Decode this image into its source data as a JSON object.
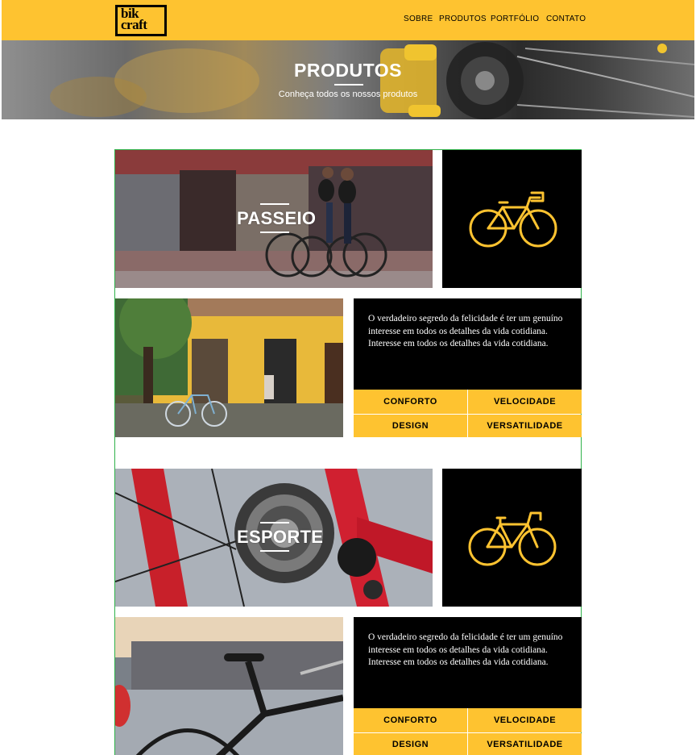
{
  "logo": {
    "line1": "bik",
    "line2": "craft"
  },
  "nav": [
    "SOBRE",
    "PRODUTOS",
    "PORTFÓLIO",
    "CONTATO"
  ],
  "banner": {
    "title": "PRODUTOS",
    "subtitle": "Conheça todos os nossos produtos"
  },
  "products": [
    {
      "title": "PASSEIO",
      "description": "O verdadeiro segredo da felicidade é ter um genuíno interesse em todos os detalhes da vida cotidiana. Interesse em todos os detalhes da vida cotidiana.",
      "features": [
        "CONFORTO",
        "VELOCIDADE",
        "DESIGN",
        "VERSATILIDADE"
      ]
    },
    {
      "title": "ESPORTE",
      "description": "O verdadeiro segredo da felicidade é ter um genuíno interesse em todos os detalhes da vida cotidiana. Interesse em todos os detalhes da vida cotidiana.",
      "features": [
        "CONFORTO",
        "VELOCIDADE",
        "DESIGN",
        "VERSATILIDADE"
      ]
    }
  ],
  "colors": {
    "accent": "#fec330",
    "dark": "#000000",
    "border": "#2fb24a"
  }
}
